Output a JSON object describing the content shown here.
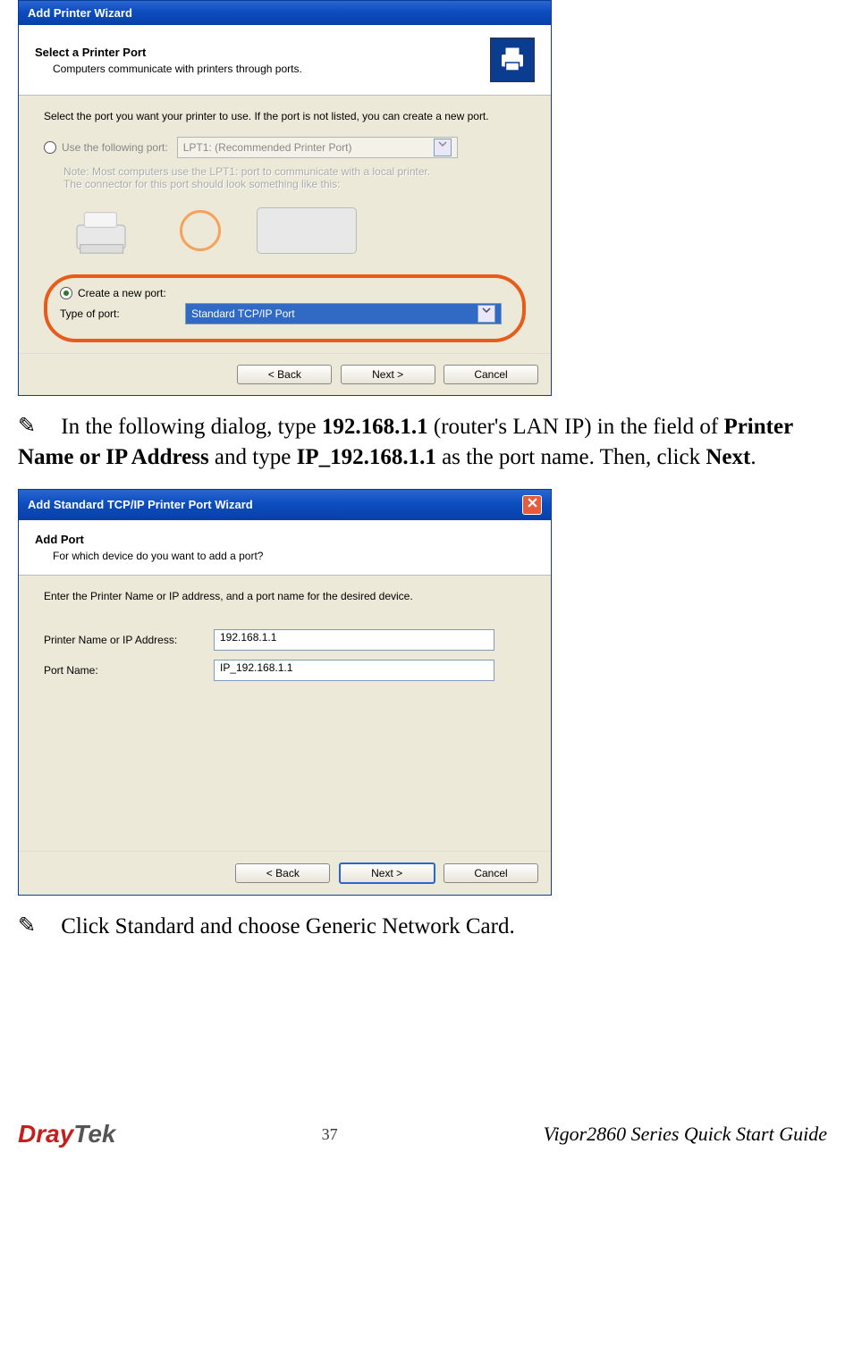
{
  "dialog1": {
    "title": "Add Printer Wizard",
    "header_title": "Select a Printer Port",
    "header_sub": "Computers communicate with printers through ports.",
    "instruction": "Select the port you want your printer to use.  If the port is not listed, you can create a new port.",
    "radio1_label": "Use the following port:",
    "dropdown1": "LPT1: (Recommended Printer Port)",
    "note_line1": "Note: Most computers use the LPT1: port to communicate with a local printer.",
    "note_line2": "The connector for this port should look something like this:",
    "radio2_label": "Create a new port:",
    "port_type_label": "Type of port:",
    "dropdown2": "Standard TCP/IP Port",
    "btn_back": "< Back",
    "btn_next": "Next >",
    "btn_cancel": "Cancel"
  },
  "step9_text_parts": {
    "p1": "In the following dialog, type ",
    "b1": "192.168.1.1",
    "p2": " (router's LAN IP) in the field of ",
    "b2": "Printer Name or IP Address",
    "p3": " and type ",
    "b3": "IP_192.168.1.1",
    "p4": " as the port name. Then, click ",
    "b4": "Next",
    "p5": "."
  },
  "dialog2": {
    "title": "Add Standard TCP/IP Printer Port Wizard",
    "header_title": "Add Port",
    "header_sub": "For which device do you want to add a port?",
    "instruction": "Enter the Printer Name or IP address, and a port name for the desired device.",
    "field1_label": "Printer Name or IP Address:",
    "field1_value": "192.168.1.1",
    "field2_label": "Port Name:",
    "field2_value": "IP_192.168.1.1",
    "btn_back": "< Back",
    "btn_next": "Next >",
    "btn_cancel": "Cancel"
  },
  "step10_text": "Click Standard and choose Generic Network Card.",
  "footer": {
    "logo_part1": "Dray",
    "logo_part2": "Tek",
    "page_num": "37",
    "guide": "Vigor2860 Series Quick Start Guide"
  }
}
